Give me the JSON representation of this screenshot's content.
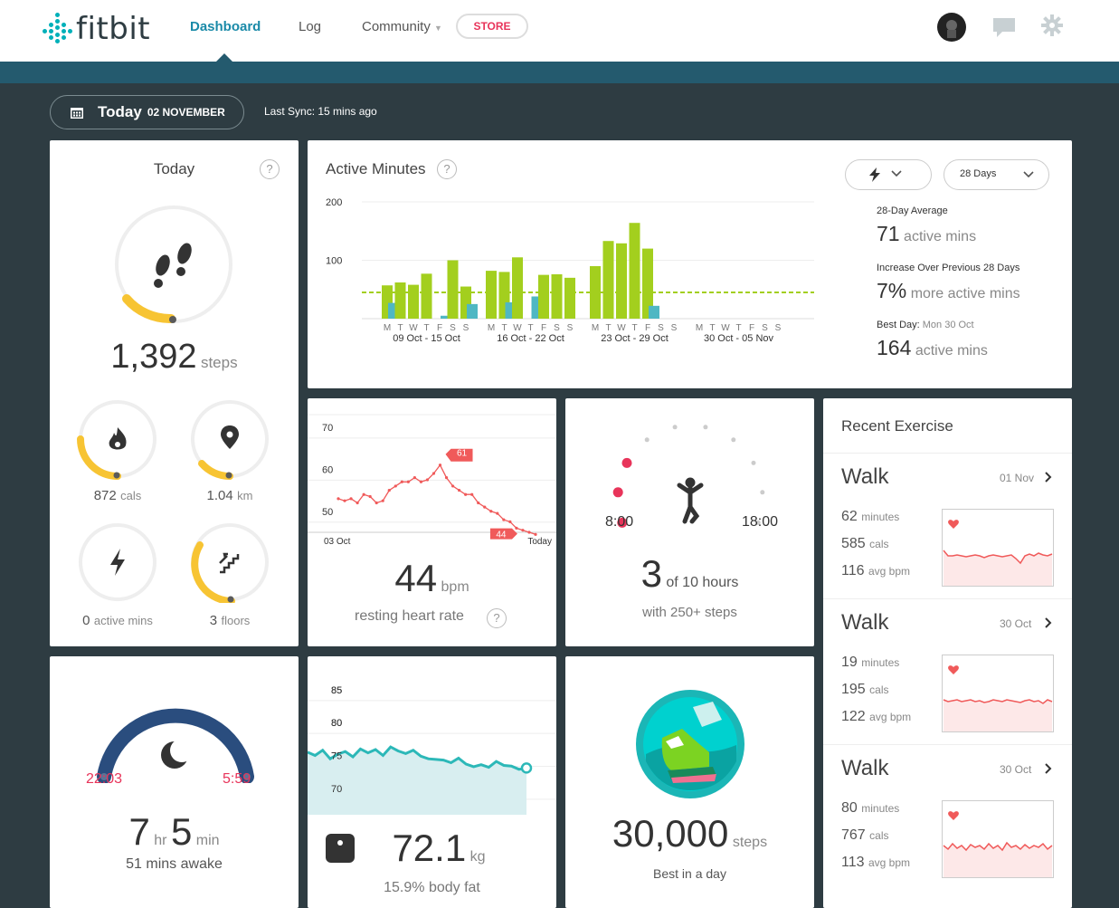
{
  "nav": {
    "logo": "fitbit",
    "dashboard": "Dashboard",
    "log": "Log",
    "community": "Community",
    "store": "STORE"
  },
  "header": {
    "today": "Today",
    "date": "02 NOVEMBER",
    "sync": "Last Sync: 15 mins ago"
  },
  "today_card": {
    "title": "Today",
    "steps_value": "1,392",
    "steps_unit": "steps",
    "cals_value": "872",
    "cals_unit": "cals",
    "km_value": "1.04",
    "km_unit": "km",
    "active_value": "0",
    "active_unit": "active mins",
    "floors_value": "3",
    "floors_unit": "floors"
  },
  "active_minutes": {
    "title": "Active Minutes",
    "filter_value": "28 Days",
    "stats": [
      {
        "label": "28-Day Average",
        "value": "71",
        "unit": "active mins"
      },
      {
        "label": "Increase Over Previous 28 Days",
        "value": "7%",
        "unit": "more active mins"
      },
      {
        "label": "Best Day:",
        "label_extra": "Mon 30 Oct",
        "value": "164",
        "unit": "active mins"
      }
    ]
  },
  "chart_data": [
    {
      "type": "bar",
      "title": "Active Minutes",
      "ylim": [
        0,
        200
      ],
      "yticks": [
        200,
        100
      ],
      "average": 45,
      "weeks": [
        "09 Oct - 15 Oct",
        "16 Oct - 22 Oct",
        "23 Oct - 29 Oct",
        "30 Oct - 05 Nov"
      ],
      "day_labels": [
        "M",
        "T",
        "W",
        "T",
        "F",
        "S",
        "S"
      ],
      "series": [
        {
          "values": [
            57,
            62,
            58,
            77,
            0,
            100,
            55,
            82,
            80,
            105,
            0,
            75,
            76,
            70,
            90,
            133,
            129,
            164,
            120
          ]
        },
        {
          "values": [
            27,
            0,
            0,
            0,
            5,
            0,
            25,
            0,
            28,
            0,
            38,
            0,
            0,
            0,
            0,
            0,
            0,
            0,
            22
          ]
        }
      ]
    },
    {
      "type": "line",
      "x_start": "03 Oct",
      "x_end": "Today",
      "yticks": [
        70,
        60,
        50
      ],
      "ylim": [
        45,
        73
      ],
      "values": [
        53,
        52.5,
        53,
        52,
        54,
        53.5,
        52,
        52.5,
        55,
        56,
        57,
        57,
        58,
        57,
        57.5,
        59,
        61,
        58,
        56,
        55,
        54,
        54,
        52,
        51,
        50,
        49.5,
        48,
        47.5,
        46,
        45.5,
        45,
        44.5
      ],
      "annotations": [
        {
          "label": "61"
        },
        {
          "label": "44"
        }
      ]
    },
    {
      "type": "area",
      "yticks": [
        85,
        80,
        75,
        70
      ],
      "ylim": [
        66,
        88
      ],
      "values": [
        75.5,
        75,
        75.8,
        74.5,
        75.2,
        75.6,
        74.8,
        76,
        75.4,
        75.9,
        75,
        76.3,
        75.7,
        75.3,
        75.8,
        74.9,
        74.5,
        74.4,
        74.3,
        73.9,
        74.6,
        73.7,
        73.3,
        73.6,
        73.2,
        74.1,
        73.5,
        73.4,
        72.9,
        73.1
      ]
    }
  ],
  "heart": {
    "value": "44",
    "unit": "bpm",
    "label": "resting heart rate",
    "x_start": "03 Oct",
    "x_end": "Today",
    "marker_high": "61",
    "marker_low": "44"
  },
  "hourly": {
    "start": "8:00",
    "end": "18:00",
    "value": "3",
    "of": "of 10 hours",
    "sub": "with 250+ steps",
    "hours_met": 3,
    "hours_goal": 10
  },
  "recent": {
    "title": "Recent Exercise",
    "items": [
      {
        "name": "Walk",
        "date": "01 Nov",
        "minutes": "62",
        "cals": "585",
        "bpm": "116",
        "minutes_unit": "minutes",
        "cals_unit": "cals",
        "bpm_unit": "avg bpm"
      },
      {
        "name": "Walk",
        "date": "30 Oct",
        "minutes": "19",
        "cals": "195",
        "bpm": "122",
        "minutes_unit": "minutes",
        "cals_unit": "cals",
        "bpm_unit": "avg bpm"
      },
      {
        "name": "Walk",
        "date": "30 Oct",
        "minutes": "80",
        "cals": "767",
        "bpm": "113",
        "minutes_unit": "minutes",
        "cals_unit": "cals",
        "bpm_unit": "avg bpm"
      }
    ]
  },
  "sleep": {
    "start": "22:03",
    "end": "5:59",
    "hr": "7",
    "hr_unit": "hr",
    "min": "5",
    "min_unit": "min",
    "awake": "51 mins awake"
  },
  "weight": {
    "value": "72.1",
    "unit": "kg",
    "fat": "15.9% body fat"
  },
  "badge": {
    "value": "30,000",
    "unit": "steps",
    "sub": "Best in a day"
  },
  "colors": {
    "accent": "#1a8aa8",
    "green": "#a3cf1e",
    "teal": "#4fb7c3",
    "yellow": "#f7c433",
    "pink": "#e8345a",
    "heart_red": "#f05a5a",
    "navy": "#2a4d7e"
  }
}
